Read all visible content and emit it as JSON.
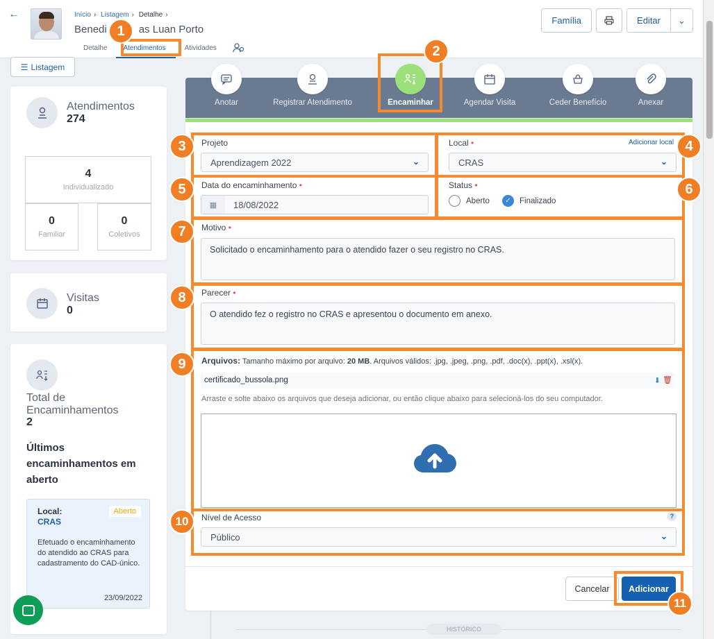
{
  "header": {
    "breadcrumb": [
      "Início",
      "Listagem",
      "Detalhe"
    ],
    "person_name_left": "Benedi",
    "person_name_right": "as Luan Porto",
    "tabs": [
      "Detalhe",
      "Atendimentos",
      "Atividades"
    ],
    "buttons": {
      "familia": "Família",
      "editar": "Editar"
    }
  },
  "sidebar": {
    "listagem_button": "Listagem",
    "atendimentos": {
      "title": "Atendimentos",
      "value": "274"
    },
    "boxes": [
      {
        "value": "4",
        "label": "Individualizado"
      },
      {
        "value": "0",
        "label": "Familiar"
      },
      {
        "value": "0",
        "label": "Coletivos"
      }
    ],
    "visitas": {
      "title": "Visitas",
      "value": "0"
    },
    "encaminhamentos": {
      "title": "Total de Encaminhamentos",
      "value": "2"
    },
    "ultimos_title": "Últimos encaminhamentos em aberto",
    "enc_card": {
      "local_label": "Local:",
      "local_value": "CRAS",
      "badge": "Aberto",
      "description": "Efetuado o encaminhamento do atendido ao CRAS para cadastramento do CAD-único.",
      "date": "23/09/2022"
    }
  },
  "toolbar": {
    "items": [
      "Anotar",
      "Registrar Atendimento",
      "Encaminhar",
      "Agendar Visita",
      "Ceder Benefício",
      "Anexar"
    ],
    "active_index": 2
  },
  "form": {
    "projeto_label": "Projeto",
    "projeto_value": "Aprendizagem 2022",
    "local_label": "Local",
    "local_value": "CRAS",
    "add_local_link": "Adicionar local",
    "data_label": "Data do encaminhamento",
    "data_value": "18/08/2022",
    "status_label": "Status",
    "status_options": [
      "Aberto",
      "Finalizado"
    ],
    "status_selected": "Finalizado",
    "motivo_label": "Motivo",
    "motivo_value": "Solicitado o encaminhamento para o atendido fazer o seu registro no CRAS.",
    "parecer_label": "Parecer",
    "parecer_value": "O atendido fez o registro no CRAS e apresentou o documento em anexo.",
    "arquivos_label": "Arquivos:",
    "arquivos_info_a": " Tamanho máximo por arquivo: ",
    "arquivos_info_b": "20 MB",
    "arquivos_info_c": ". Arquivos válidos: .jpg, .jpeg, .png, .pdf, .doc(x), .ppt(x), .xsl(x).",
    "file_name": "certificado_bussola.png",
    "drop_hint": "Arraste e solte abaixo os arquivos que deseja adicionar, ou então clique abaixo para selecioná-los do seu computador.",
    "nivel_label": "Nível de Acesso",
    "nivel_value": "Público",
    "help": "?",
    "cancel": "Cancelar",
    "add": "Adicionar"
  },
  "historico": "HISTÓRICO",
  "annotations": [
    "1",
    "2",
    "3",
    "4",
    "5",
    "6",
    "7",
    "8",
    "9",
    "10",
    "11"
  ],
  "colors": {
    "primary": "#1561b0",
    "accent_green": "#9be07a",
    "annotation": "#f07e24"
  }
}
